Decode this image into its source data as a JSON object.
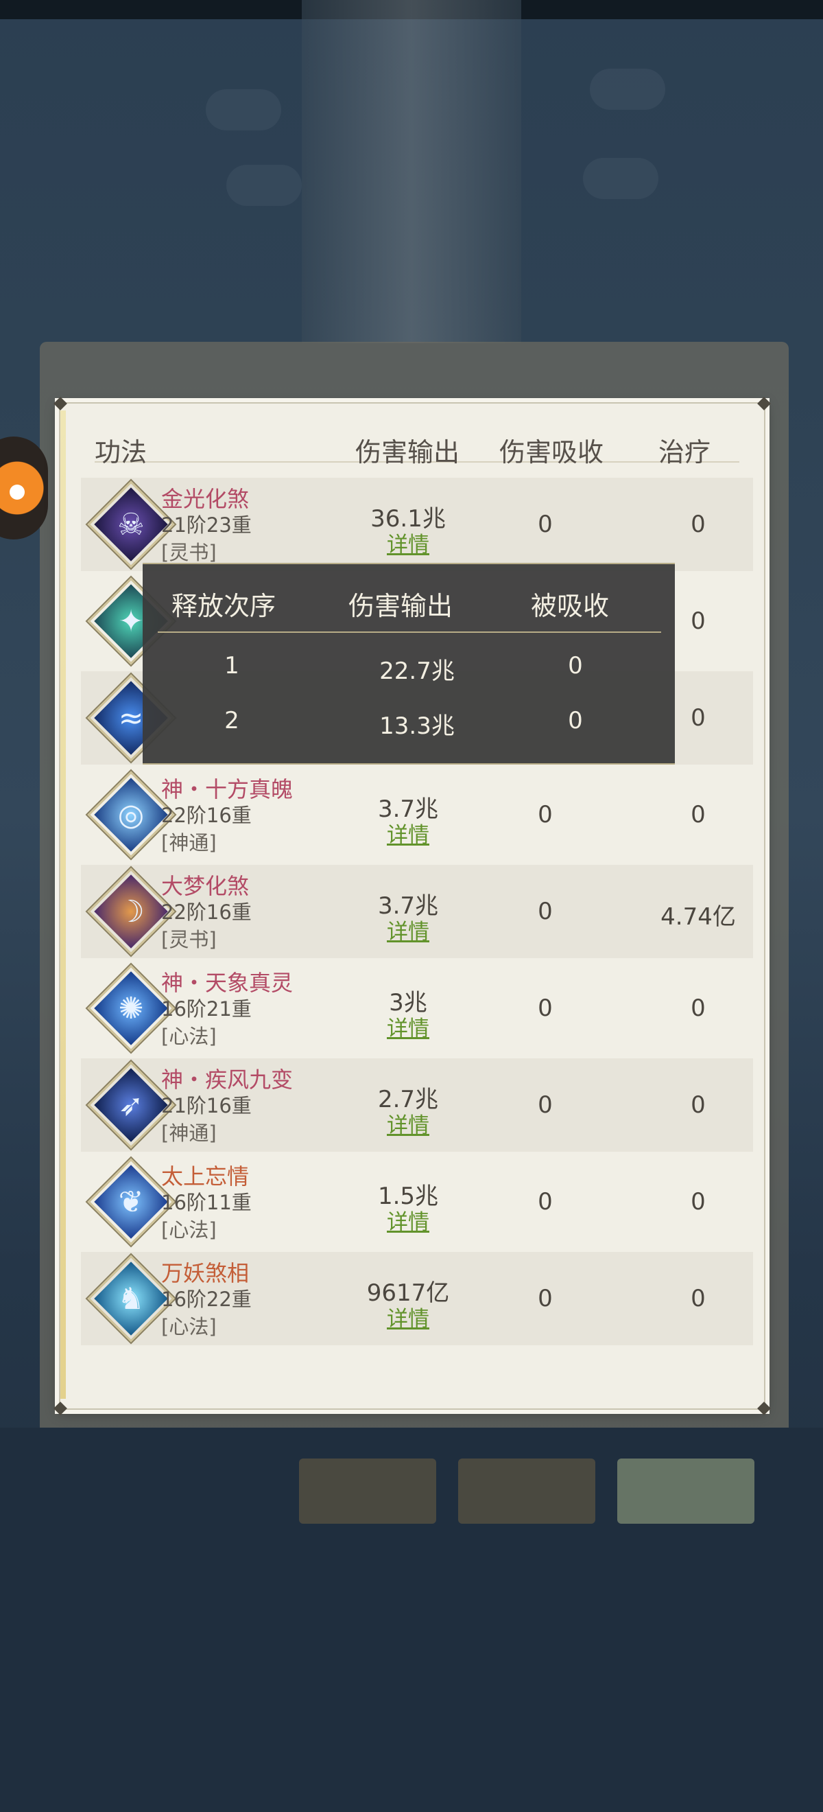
{
  "colors": {
    "name_pink": "#b34b66",
    "name_orange": "#c45e38",
    "detail_green": "#62932b",
    "panel_bg": "#f1efe6",
    "tooltip_bg": "#3a3a3a"
  },
  "table": {
    "headers": {
      "name": "功法",
      "damage": "伤害输出",
      "absorb": "伤害吸收",
      "heal": "治疗"
    },
    "detail_label": "详情",
    "rows": [
      {
        "name": "金光化煞",
        "level": "21阶23重",
        "type": "[灵书]",
        "damage": "36.1兆",
        "absorb": "0",
        "heal": "0",
        "icon": "dark-demon-icon"
      },
      {
        "name": "",
        "level": "",
        "type": "",
        "damage": "",
        "absorb": "",
        "heal": "0",
        "icon": "spear-icon"
      },
      {
        "name": "",
        "level": "",
        "type": "",
        "damage": "",
        "absorb": "",
        "heal": "0",
        "icon": "dragon-icon"
      },
      {
        "name": "神・十方真魄",
        "level": "22阶16重",
        "type": "[神通]",
        "damage": "3.7兆",
        "absorb": "0",
        "heal": "0",
        "icon": "vortex-icon"
      },
      {
        "name": "大梦化煞",
        "level": "22阶16重",
        "type": "[灵书]",
        "damage": "3.7兆",
        "absorb": "0",
        "heal": "4.74亿",
        "icon": "dream-icon"
      },
      {
        "name": "神・天象真灵",
        "level": "16阶21重",
        "type": "[心法]",
        "damage": "3兆",
        "absorb": "0",
        "heal": "0",
        "icon": "celestial-icon"
      },
      {
        "name": "神・疾风九变",
        "level": "21阶16重",
        "type": "[神通]",
        "damage": "2.7兆",
        "absorb": "0",
        "heal": "0",
        "icon": "wind-icon"
      },
      {
        "name": "太上忘情",
        "level": "16阶11重",
        "type": "[心法]",
        "damage": "1.5兆",
        "absorb": "0",
        "heal": "0",
        "icon": "spirit-fox-icon"
      },
      {
        "name": "万妖煞相",
        "level": "16阶22重",
        "type": "[心法]",
        "damage": "9617亿",
        "absorb": "0",
        "heal": "0",
        "icon": "wolf-icon"
      }
    ]
  },
  "tooltip": {
    "headers": {
      "order": "释放次序",
      "damage": "伤害输出",
      "absorbed": "被吸收"
    },
    "rows": [
      {
        "order": "1",
        "damage": "22.7兆",
        "absorbed": "0"
      },
      {
        "order": "2",
        "damage": "13.3兆",
        "absorbed": "0"
      }
    ]
  }
}
